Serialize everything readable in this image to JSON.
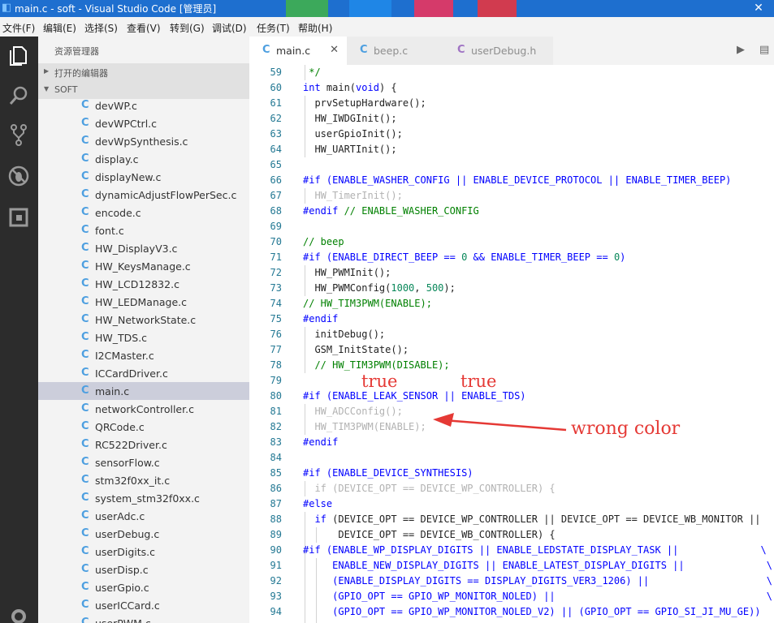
{
  "window": {
    "title": "main.c - soft - Visual Studio Code [管理员]",
    "close_glyph": "✕"
  },
  "menubar": [
    {
      "label": "文件(F)"
    },
    {
      "label": "编辑(E)"
    },
    {
      "label": "选择(S)"
    },
    {
      "label": "查看(V)"
    },
    {
      "label": "转到(G)"
    },
    {
      "label": "调试(D)"
    },
    {
      "label": "任务(T)"
    },
    {
      "label": "帮助(H)"
    }
  ],
  "activitybar": {
    "icons": [
      "explorer-icon",
      "search-icon",
      "source-control-icon",
      "debug-icon",
      "extensions-icon",
      "settings-gear-icon"
    ]
  },
  "sidebar": {
    "title": "资源管理器",
    "open_editors_label": "打开的编辑器",
    "folder_label": "SOFT",
    "files": [
      "devWP.c",
      "devWPCtrl.c",
      "devWpSynthesis.c",
      "display.c",
      "displayNew.c",
      "dynamicAdjustFlowPerSec.c",
      "encode.c",
      "font.c",
      "HW_DisplayV3.c",
      "HW_KeysManage.c",
      "HW_LCD12832.c",
      "HW_LEDManage.c",
      "HW_NetworkState.c",
      "HW_TDS.c",
      "I2CMaster.c",
      "ICCardDriver.c",
      "main.c",
      "networkController.c",
      "QRCode.c",
      "RC522Driver.c",
      "sensorFlow.c",
      "stm32f0xx_it.c",
      "system_stm32f0xx.c",
      "userAdc.c",
      "userDebug.c",
      "userDigits.c",
      "userDisp.c",
      "userGpio.c",
      "userICCard.c",
      "userPWM.c"
    ],
    "selected_file": "main.c"
  },
  "tabs": [
    {
      "label": "main.c",
      "active": true,
      "close": "✕"
    },
    {
      "label": "beep.c",
      "active": false
    },
    {
      "label": "userDebug.h",
      "active": false
    }
  ],
  "editor_actions": {
    "run": "▶",
    "split": "▤"
  },
  "code": [
    {
      "n": "59",
      "t": " */",
      "c": "cm"
    },
    {
      "n": "60",
      "t": "int main(void) {",
      "c": "fn"
    },
    {
      "n": "61",
      "t": "  prvSetupHardware();",
      "c": "plain"
    },
    {
      "n": "62",
      "t": "  HW_IWDGInit();",
      "c": "plain"
    },
    {
      "n": "63",
      "t": "  userGpioInit();",
      "c": "plain"
    },
    {
      "n": "64",
      "t": "  HW_UARTInit();",
      "c": "plain"
    },
    {
      "n": "65",
      "t": "",
      "c": "plain"
    },
    {
      "n": "66",
      "t": "#if (ENABLE_WASHER_CONFIG || ENABLE_DEVICE_PROTOCOL || ENABLE_TIMER_BEEP)",
      "c": "mac"
    },
    {
      "n": "67",
      "t": "  HW_TimerInit();",
      "c": "dim"
    },
    {
      "n": "68",
      "t": "#endif // ENABLE_WASHER_CONFIG",
      "c": "endif"
    },
    {
      "n": "69",
      "t": "",
      "c": "plain"
    },
    {
      "n": "70",
      "t": "// beep",
      "c": "cm"
    },
    {
      "n": "71",
      "t": "#if (ENABLE_DIRECT_BEEP == 0 && ENABLE_TIMER_BEEP == 0)",
      "c": "mac"
    },
    {
      "n": "72",
      "t": "  HW_PWMInit();",
      "c": "plain"
    },
    {
      "n": "73",
      "t": "  HW_PWMConfig(1000, 500);",
      "c": "plain"
    },
    {
      "n": "74",
      "t": "// HW_TIM3PWM(ENABLE);",
      "c": "cm"
    },
    {
      "n": "75",
      "t": "#endif",
      "c": "mac"
    },
    {
      "n": "76",
      "t": "  initDebug();",
      "c": "plain"
    },
    {
      "n": "77",
      "t": "  GSM_InitState();",
      "c": "plain"
    },
    {
      "n": "78",
      "t": "  // HW_TIM3PWM(DISABLE);",
      "c": "cm"
    },
    {
      "n": "79",
      "t": "",
      "c": "plain"
    },
    {
      "n": "80",
      "t": "#if (ENABLE_LEAK_SENSOR || ENABLE_TDS)",
      "c": "mac"
    },
    {
      "n": "81",
      "t": "  HW_ADCConfig();",
      "c": "dim"
    },
    {
      "n": "82",
      "t": "  HW_TIM3PWM(ENABLE);",
      "c": "dim"
    },
    {
      "n": "83",
      "t": "#endif",
      "c": "mac"
    },
    {
      "n": "84",
      "t": "",
      "c": "plain"
    },
    {
      "n": "85",
      "t": "#if (ENABLE_DEVICE_SYNTHESIS)",
      "c": "mac"
    },
    {
      "n": "86",
      "t": "  if (DEVICE_OPT == DEVICE_WP_CONTROLLER) {",
      "c": "dim"
    },
    {
      "n": "87",
      "t": "#else",
      "c": "mac"
    },
    {
      "n": "88",
      "t": "  if (DEVICE_OPT == DEVICE_WP_CONTROLLER || DEVICE_OPT == DEVICE_WB_MONITOR ||",
      "c": "if"
    },
    {
      "n": "89",
      "t": "      DEVICE_OPT == DEVICE_WB_CONTROLLER) {",
      "c": "plain"
    },
    {
      "n": "90",
      "t": "#if (ENABLE_WP_DISPLAY_DIGITS || ENABLE_LEDSTATE_DISPLAY_TASK ||              \\",
      "c": "mac"
    },
    {
      "n": "91",
      "t": "     ENABLE_NEW_DISPLAY_DIGITS || ENABLE_LATEST_DISPLAY_DIGITS ||              \\",
      "c": "mac"
    },
    {
      "n": "92",
      "t": "     (ENABLE_DISPLAY_DIGITS == DISPLAY_DIGITS_VER3_1206) ||                    \\",
      "c": "mac"
    },
    {
      "n": "93",
      "t": "     (GPIO_OPT == GPIO_WP_MONITOR_NOLED) ||                                    \\",
      "c": "mac"
    },
    {
      "n": "94",
      "t": "     (GPIO_OPT == GPIO_WP_MONITOR_NOLED_V2) || (GPIO_OPT == GPIO_SI_JI_MU_GE))",
      "c": "mac"
    }
  ],
  "annotations": {
    "true_left": "true",
    "true_right": "true",
    "wrong_color": "wrong color",
    "annotation_color": "#e53935"
  }
}
